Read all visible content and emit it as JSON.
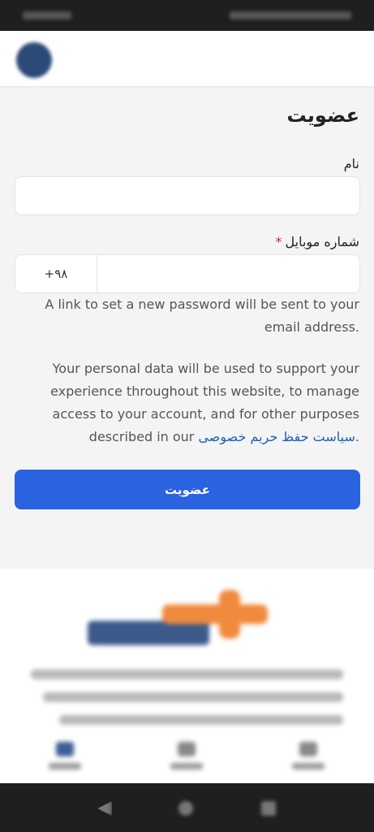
{
  "form": {
    "title": "عضویت",
    "name_label": "نام",
    "name_value": "",
    "mobile_label": "شماره موبایل",
    "required_mark": "*",
    "country_code": "+۹۸",
    "mobile_value": "",
    "password_note": "A link to set a new password will be sent to your email address.",
    "privacy_text_before": "Your personal data will be used to support your experience throughout this website, to manage access to your account, and for other purposes described in our",
    "privacy_link": "سیاست حفظ حریم خصوصی",
    "privacy_text_after": ".",
    "submit_label": "عضویت"
  },
  "colors": {
    "accent": "#2a63e0",
    "link": "#1f5fb8",
    "required": "#d42424",
    "background": "#f4f4f4"
  }
}
